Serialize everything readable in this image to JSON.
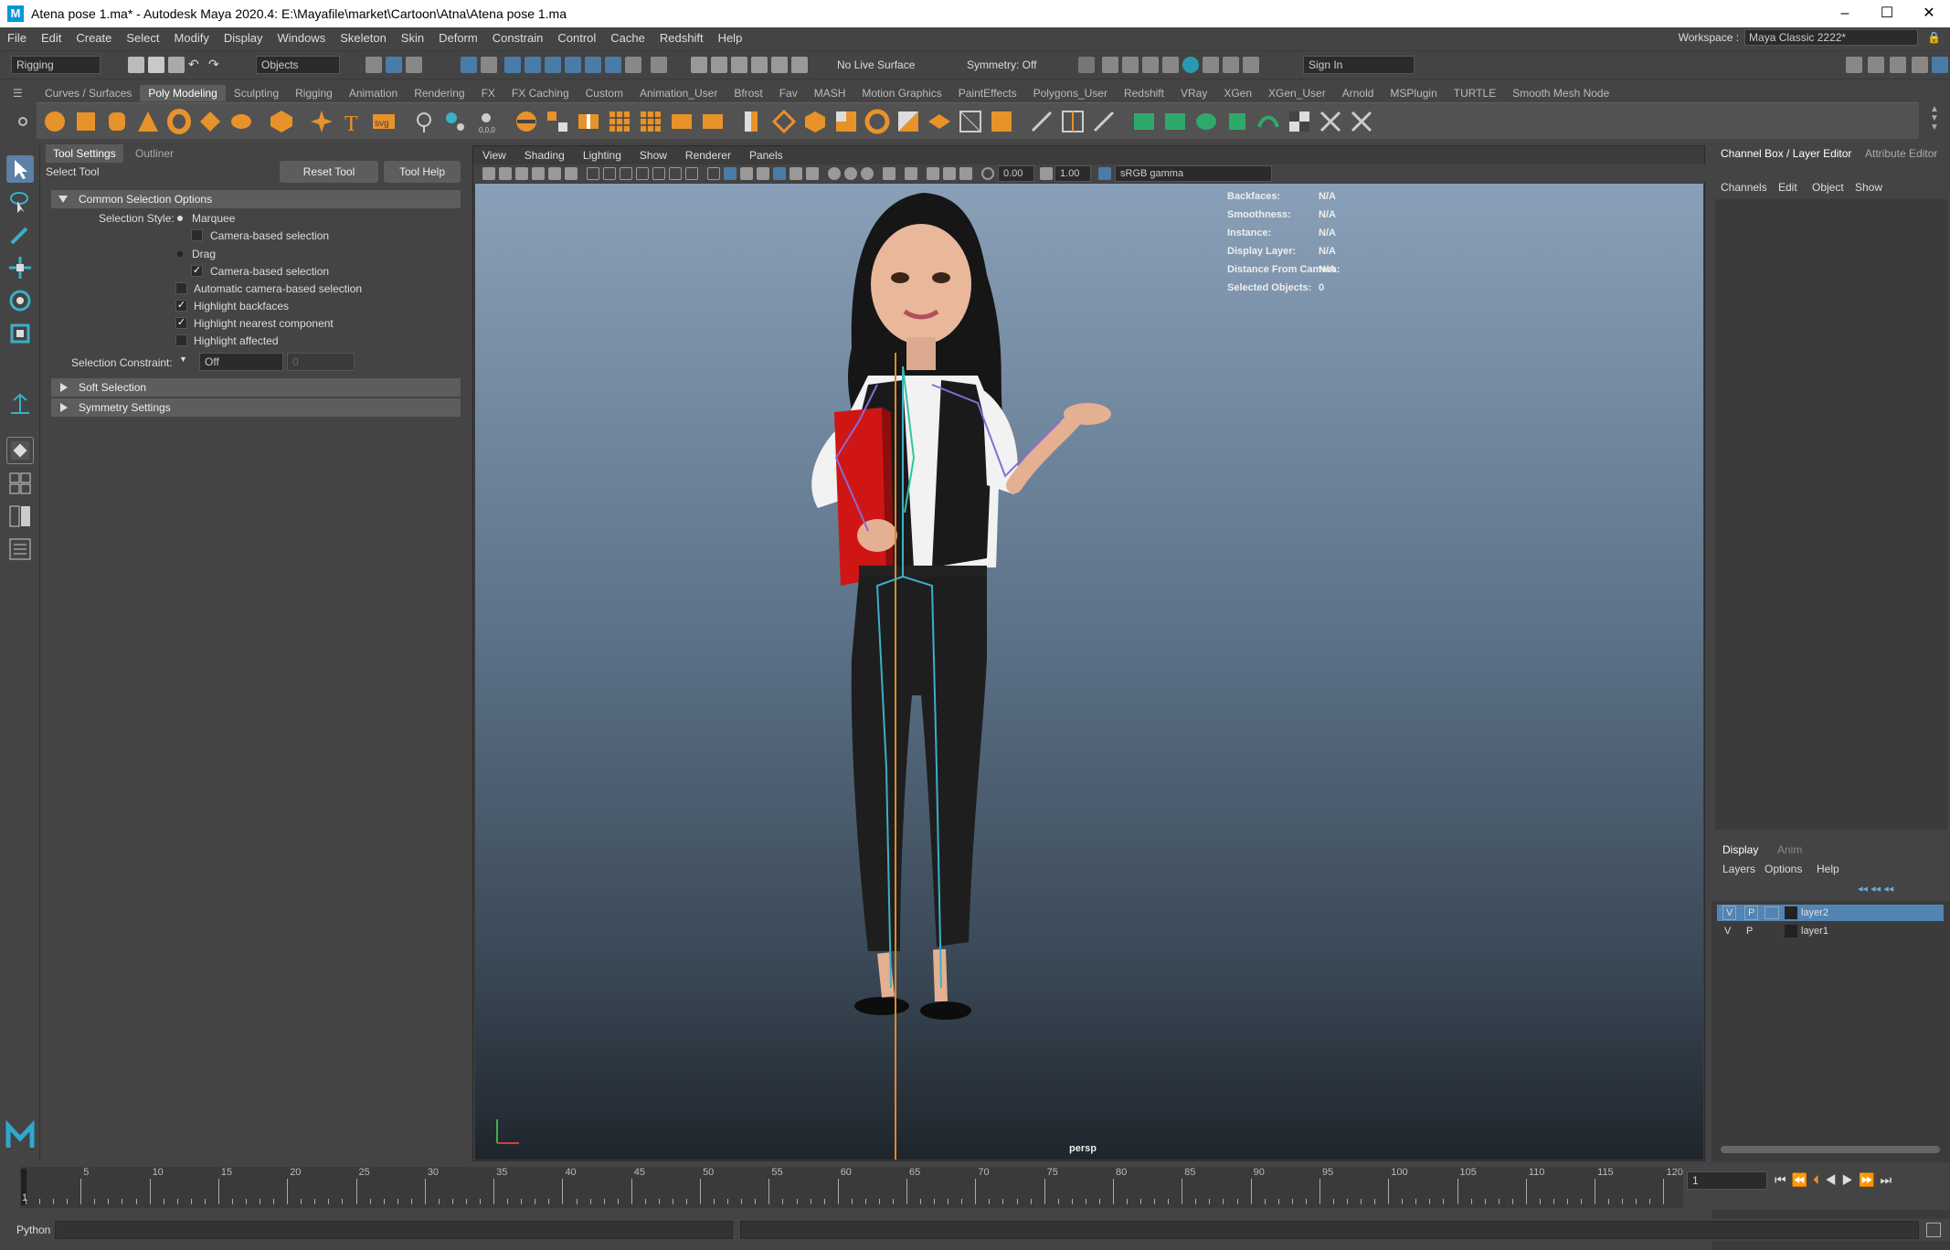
{
  "window": {
    "title": "Atena pose 1.ma* - Autodesk Maya 2020.4: E:\\Mayafile\\market\\Cartoon\\Atna\\Atena pose 1.ma",
    "logo": "M"
  },
  "menubar": [
    "File",
    "Edit",
    "Create",
    "Select",
    "Modify",
    "Display",
    "Windows",
    "Skeleton",
    "Skin",
    "Deform",
    "Constrain",
    "Control",
    "Cache",
    "Redshift",
    "Help"
  ],
  "workspace": {
    "label": "Workspace :",
    "value": "Maya Classic 2222*"
  },
  "statusline": {
    "menuset": "Rigging",
    "select_mode": "Objects",
    "live_surface": "No Live Surface",
    "symmetry": "Symmetry: Off",
    "sign_in": "Sign In"
  },
  "shelf_tabs": [
    "Curves / Surfaces",
    "Poly Modeling",
    "Sculpting",
    "Rigging",
    "Animation",
    "Rendering",
    "FX",
    "FX Caching",
    "Custom",
    "Animation_User",
    "Bfrost",
    "Fav",
    "MASH",
    "Motion Graphics",
    "PaintEffects",
    "Polygons_User",
    "Redshift",
    "VRay",
    "XGen",
    "XGen_User",
    "Arnold",
    "MSPlugin",
    "TURTLE",
    "Smooth Mesh Node"
  ],
  "shelf_active": "Poly Modeling",
  "tool_panel": {
    "tabs": [
      "Tool Settings",
      "Outliner"
    ],
    "tool_name": "Select Tool",
    "reset_button": "Reset Tool",
    "help_button": "Tool Help",
    "section_common": "Common Selection Options",
    "selection_style_label": "Selection Style:",
    "marquee": "Marquee",
    "camera_based_1": "Camera-based selection",
    "drag": "Drag",
    "camera_based_2": "Camera-based selection",
    "auto_camera": "Automatic camera-based selection",
    "highlight_backfaces": "Highlight backfaces",
    "highlight_nearest": "Highlight nearest component",
    "highlight_affected": "Highlight affected",
    "constraint_label": "Selection Constraint:",
    "constraint_value": "Off",
    "constraint_num": "0",
    "section_soft": "Soft Selection",
    "section_symmetry": "Symmetry Settings"
  },
  "viewport": {
    "menus": [
      "View",
      "Shading",
      "Lighting",
      "Show",
      "Renderer",
      "Panels"
    ],
    "exposure": "0.00",
    "gamma": "1.00",
    "colorspace": "sRGB gamma",
    "camera": "persp",
    "hud": [
      {
        "label": "Backfaces:",
        "value": "N/A"
      },
      {
        "label": "Smoothness:",
        "value": "N/A"
      },
      {
        "label": "Instance:",
        "value": "N/A"
      },
      {
        "label": "Display Layer:",
        "value": "N/A"
      },
      {
        "label": "Distance From Camera:",
        "value": "N/A"
      },
      {
        "label": "Selected Objects:",
        "value": "0"
      }
    ]
  },
  "channel_box": {
    "tabs": [
      "Channel Box / Layer Editor",
      "Attribute Editor"
    ],
    "menus": [
      "Channels",
      "Edit",
      "Object",
      "Show"
    ],
    "layer_tabs": [
      "Display",
      "Anim"
    ],
    "layer_menus": [
      "Layers",
      "Options",
      "Help"
    ],
    "layers": [
      {
        "v": "V",
        "p": "P",
        "name": "layer2",
        "selected": true
      },
      {
        "v": "V",
        "p": "P",
        "name": "layer1",
        "selected": false
      }
    ]
  },
  "timeline": {
    "ticks": [
      "5",
      "10",
      "15",
      "20",
      "25",
      "30",
      "35",
      "40",
      "45",
      "50",
      "55",
      "60",
      "65",
      "70",
      "75",
      "80",
      "85",
      "90",
      "95",
      "100",
      "105",
      "110",
      "115",
      "120"
    ],
    "current_frame": "1",
    "frame_field": "1"
  },
  "command_line": {
    "label": "Python"
  },
  "colors": {
    "bg": "#444444",
    "accent": "#4a7ca8",
    "selected_layer": "#5285b4",
    "shelf_icon": "#e8922a"
  }
}
